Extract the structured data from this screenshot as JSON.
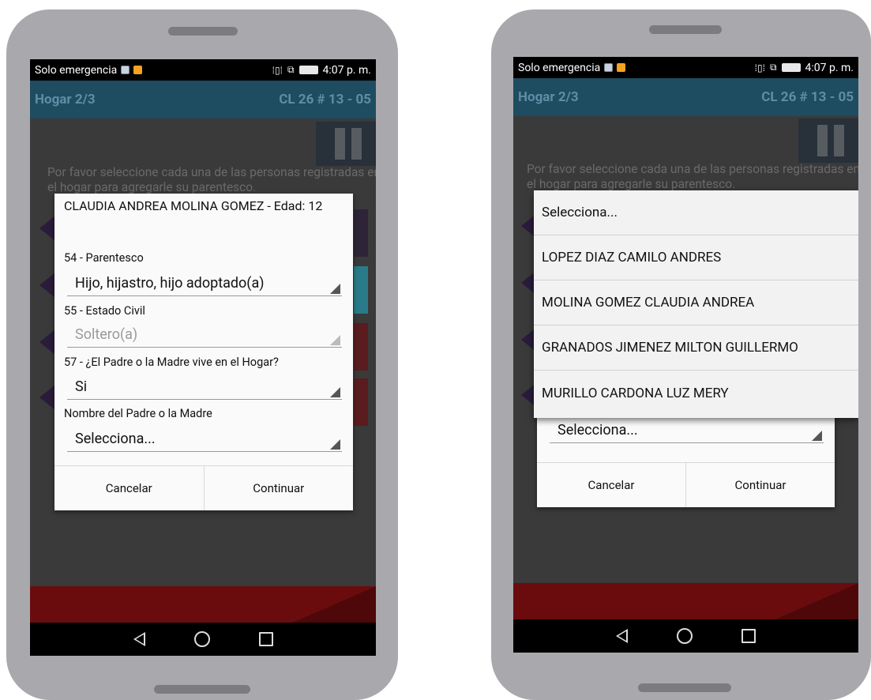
{
  "status_bar": {
    "carrier": "Solo emergencia",
    "time": "4:07 p. m."
  },
  "header": {
    "title": "Hogar 2/3",
    "address": "CL 26 # 13 - 05"
  },
  "instructions": "Por favor seleccione cada una de las personas registradas en el hogar para agregarle su parentesco.",
  "dialog": {
    "title": "CLAUDIA ANDREA MOLINA GOMEZ - Edad: 12",
    "fields": [
      {
        "label": "54 - Parentesco",
        "value": "Hijo, hijastro, hijo adoptado(a)"
      },
      {
        "label": "55 - Estado Civil",
        "value": "Soltero(a)"
      },
      {
        "label": "57 - ¿El Padre o la Madre vive en el Hogar?",
        "value": "Si"
      },
      {
        "label": "Nombre del Padre o la Madre",
        "value": "Selecciona..."
      }
    ],
    "cancel_label": "Cancelar",
    "continue_label": "Continuar"
  },
  "dropdown": {
    "options": [
      "Selecciona...",
      "LOPEZ DIAZ CAMILO ANDRES",
      "MOLINA GOMEZ CLAUDIA ANDREA",
      "GRANADOS JIMENEZ MILTON GUILLERMO",
      "MURILLO CARDONA LUZ MERY"
    ]
  },
  "colors": {
    "header": "#1e4c60",
    "bottom_bar": "#6a0c0e",
    "phone_frame": "#a9a9ad"
  }
}
